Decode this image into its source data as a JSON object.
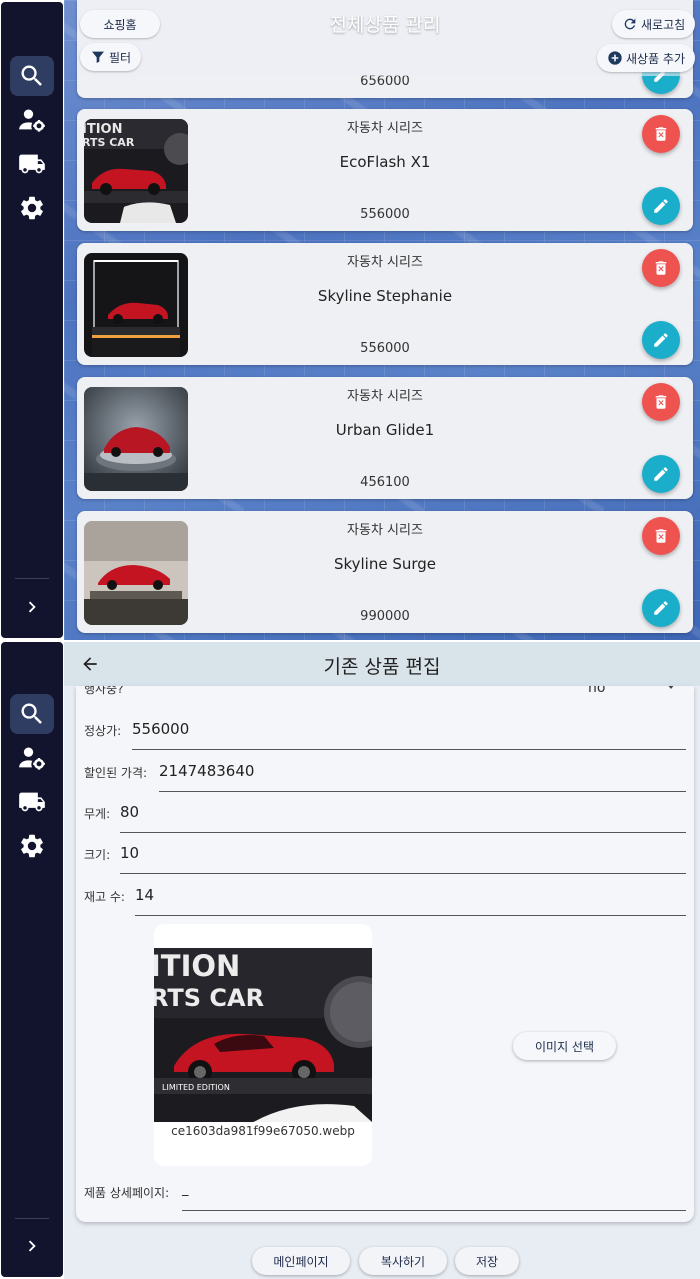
{
  "list_screen": {
    "title": "전체상품 관리",
    "shop_home_label": "쇼핑홈",
    "filter_label": "필터",
    "refresh_label": "새로고침",
    "add_product_label": "새상품 추가",
    "partial_price": "656000",
    "products": [
      {
        "category": "자동차 시리즈",
        "name": "EcoFlash X1",
        "price": "556000"
      },
      {
        "category": "자동차 시리즈",
        "name": "Skyline Stephanie",
        "price": "556000"
      },
      {
        "category": "자동차 시리즈",
        "name": "Urban Glide1",
        "price": "456100"
      },
      {
        "category": "자동차 시리즈",
        "name": "Skyline Surge",
        "price": "990000"
      }
    ]
  },
  "edit_screen": {
    "title": "기존 상품 편집",
    "event_label": "행사중?",
    "event_value": "no",
    "fields": [
      {
        "label": "정상가:",
        "value": "556000"
      },
      {
        "label": "할인된 가격:",
        "value": "2147483640"
      },
      {
        "label": "무게:",
        "value": "80"
      },
      {
        "label": "크기:",
        "value": "10"
      },
      {
        "label": "재고 수:",
        "value": "14"
      }
    ],
    "image_filename": "ce1603da981f99e67050.webp",
    "image_text_top": "ITION",
    "image_text_mid": "RTS CAR",
    "image_text_badge": "LIMITED EDITION",
    "select_image_label": "이미지 선택",
    "detail_page_label": "제품 상세페이지:",
    "detail_page_value": "_",
    "main_page_label": "메인페이지",
    "copy_label": "복사하기",
    "save_label": "저장"
  },
  "colors": {
    "sidebar": "#12142e",
    "delete": "#ef5350",
    "edit": "#1aaecb",
    "car_red": "#c41422"
  },
  "sidebar_icons": [
    "search-icon",
    "user-gear-icon",
    "truck-icon",
    "settings-icon",
    "chevron-right-icon"
  ]
}
